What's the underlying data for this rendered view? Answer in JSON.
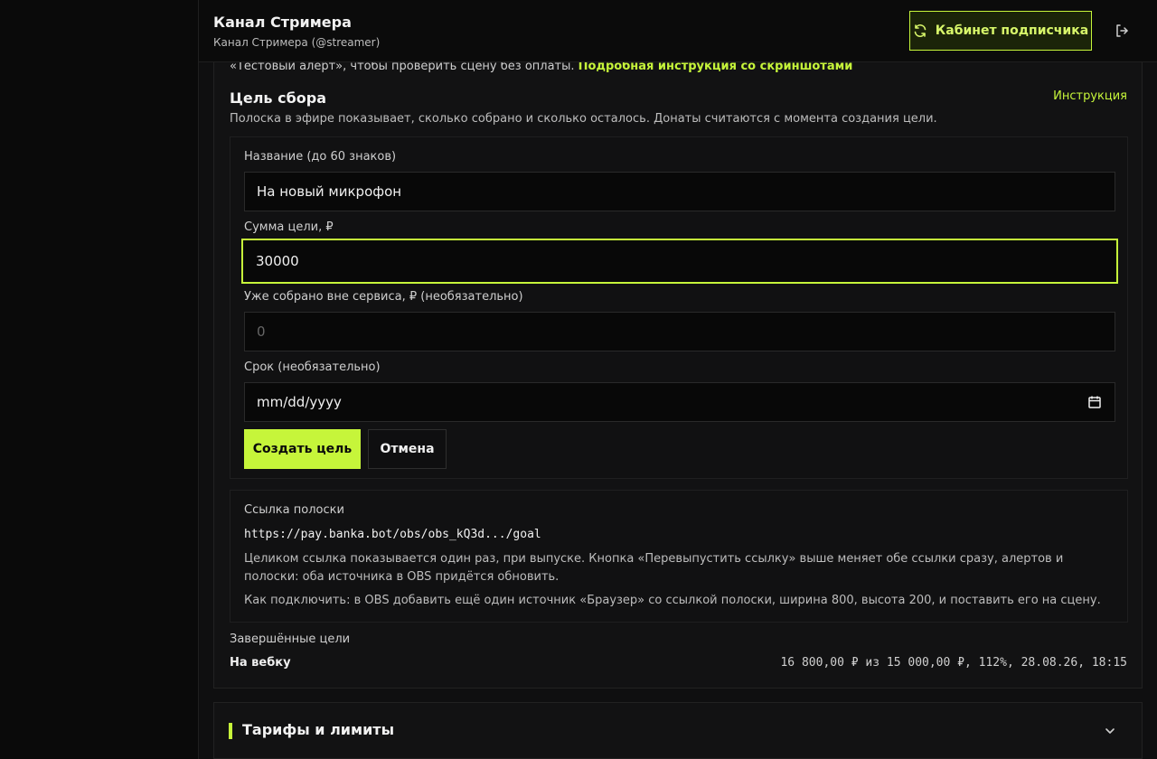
{
  "header": {
    "title": "Канал Стримера",
    "subtitle": "Канал Стримера (@streamer)",
    "cabinet_button": "Кабинет подписчика"
  },
  "intro": {
    "text": "«Тестовый алерт», чтобы проверить сцену без оплаты.",
    "link": "Подробная инструкция со скриншотами"
  },
  "goal": {
    "title": "Цель сбора",
    "help_link": "Инструкция",
    "description": "Полоска в эфире показывает, сколько собрано и сколько осталось. Донаты считаются с момента создания цели.",
    "form": {
      "name_label": "Название (до 60 знаков)",
      "name_value": "На новый микрофон",
      "amount_label": "Сумма цели, ₽",
      "amount_value": "30000",
      "collected_label": "Уже собрано вне сервиса, ₽ (необязательно)",
      "collected_placeholder": "0",
      "deadline_label": "Срок (необязательно)",
      "deadline_placeholder": "mm/dd/yyyy",
      "create_button": "Создать цель",
      "cancel_button": "Отмена"
    }
  },
  "bar_link": {
    "label": "Ссылка полоски",
    "url": "https://pay.banka.bot/obs/obs_kQ3d.../goal",
    "note1": "Целиком ссылка показывается один раз, при выпуске. Кнопка «Перевыпустить ссылку» выше меняет обе ссылки сразу, алертов и полоски: оба источника в OBS придётся обновить.",
    "note2": "Как подключить: в OBS добавить ещё один источник «Браузер» со ссылкой полоски, ширина 800, высота 200, и поставить его на сцену."
  },
  "completed": {
    "label": "Завершённые цели",
    "items": [
      {
        "name": "На вебку",
        "stats": "16 800,00 ₽ из 15 000,00 ₽, 112%, 28.08.26, 18:15"
      }
    ]
  },
  "tariffs": {
    "title": "Тарифы и лимиты"
  },
  "colors": {
    "accent": "#c6f53a",
    "background": "#0f0f10"
  }
}
